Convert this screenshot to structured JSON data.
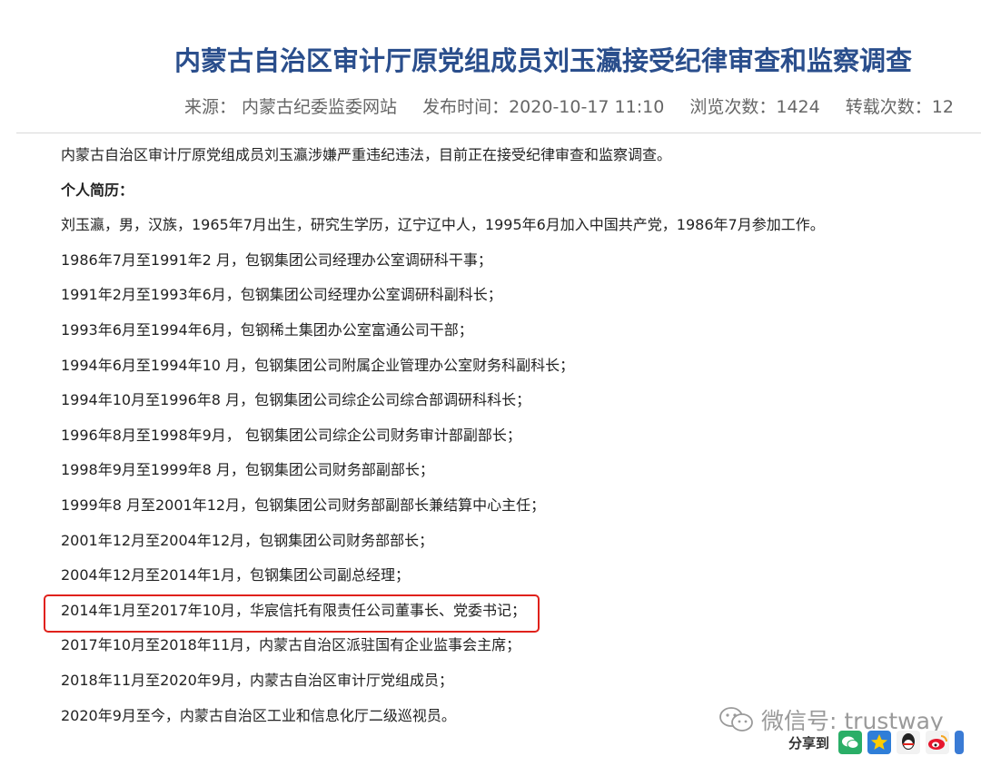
{
  "article": {
    "title": "内蒙古自治区审计厅原党组成员刘玉瀛接受纪律审查和监察调查",
    "meta": {
      "source": "来源： 内蒙古纪委监委网站",
      "time": "发布时间：2020-10-17 11:10",
      "views": "浏览次数：1424",
      "reposts": "转载次数：12"
    },
    "paragraphs": [
      "内蒙古自治区审计厅原党组成员刘玉瀛涉嫌严重违纪违法，目前正在接受纪律审查和监察调查。",
      "个人简历：",
      "刘玉瀛，男，汉族，1965年7月出生，研究生学历，辽宁辽中人，1995年6月加入中国共产党，1986年7月参加工作。",
      "1986年7月至1991年2 月，包钢集团公司经理办公室调研科干事；",
      "1991年2月至1993年6月，包钢集团公司经理办公室调研科副科长；",
      "1993年6月至1994年6月，包钢稀土集团办公室富通公司干部；",
      "1994年6月至1994年10 月，包钢集团公司附属企业管理办公室财务科副科长；",
      "1994年10月至1996年8 月，包钢集团公司综企公司综合部调研科科长；",
      "1996年8月至1998年9月， 包钢集团公司综企公司财务审计部副部长；",
      "1998年9月至1999年8 月，包钢集团公司财务部副部长；",
      "1999年8 月至2001年12月，包钢集团公司财务部副部长兼结算中心主任；",
      "2001年12月至2004年12月，包钢集团公司财务部部长；",
      "2004年12月至2014年1月，包钢集团公司副总经理；",
      "2014年1月至2017年10月，华宸信托有限责任公司董事长、党委书记；",
      "2017年10月至2018年11月，内蒙古自治区派驻国有企业监事会主席；",
      "2018年11月至2020年9月，内蒙古自治区审计厅党组成员；",
      "2020年9月至今，内蒙古自治区工业和信息化厅二级巡视员。"
    ]
  },
  "watermark": {
    "text": "微信号: trustway",
    "icon": "wechat-logo-icon"
  },
  "share": {
    "label": "分享到",
    "icons": [
      "wechat-icon",
      "qzone-icon",
      "qq-icon",
      "weibo-icon"
    ]
  },
  "colors": {
    "title": "#2a4e8c",
    "highlight_border": "#e0211b"
  }
}
